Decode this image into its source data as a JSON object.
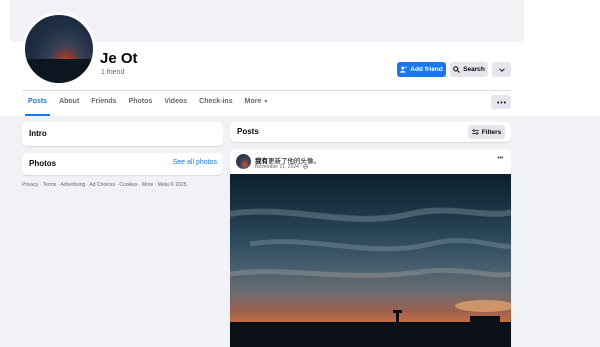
{
  "profile": {
    "name": "Je Ot",
    "friends": "1 friend"
  },
  "actions": {
    "add_friend": "Add friend",
    "search": "Search"
  },
  "tabs": [
    {
      "label": "Posts",
      "active": true
    },
    {
      "label": "About"
    },
    {
      "label": "Friends"
    },
    {
      "label": "Photos"
    },
    {
      "label": "Videos"
    },
    {
      "label": "Check-ins"
    },
    {
      "label": "More"
    }
  ],
  "left": {
    "intro_title": "Intro",
    "photos_title": "Photos",
    "see_all_photos": "See all photos",
    "footer": "Privacy · Terms · Advertising · Ad Choices · Cookies · More · Meta © 2025"
  },
  "posts": {
    "title": "Posts",
    "filters": "Filters",
    "post": {
      "author": "我有",
      "action_text": "更新了他的头像。",
      "date": "November 21, 2024 ·"
    }
  },
  "colors": {
    "accent": "#1877f2",
    "background": "#f0f2f5",
    "button_gray": "#e4e6eb"
  },
  "icons": [
    "add-person-icon",
    "search-icon",
    "chevron-down-icon",
    "more-dots-icon",
    "filters-icon",
    "globe-icon",
    "ad-choices-icon"
  ]
}
